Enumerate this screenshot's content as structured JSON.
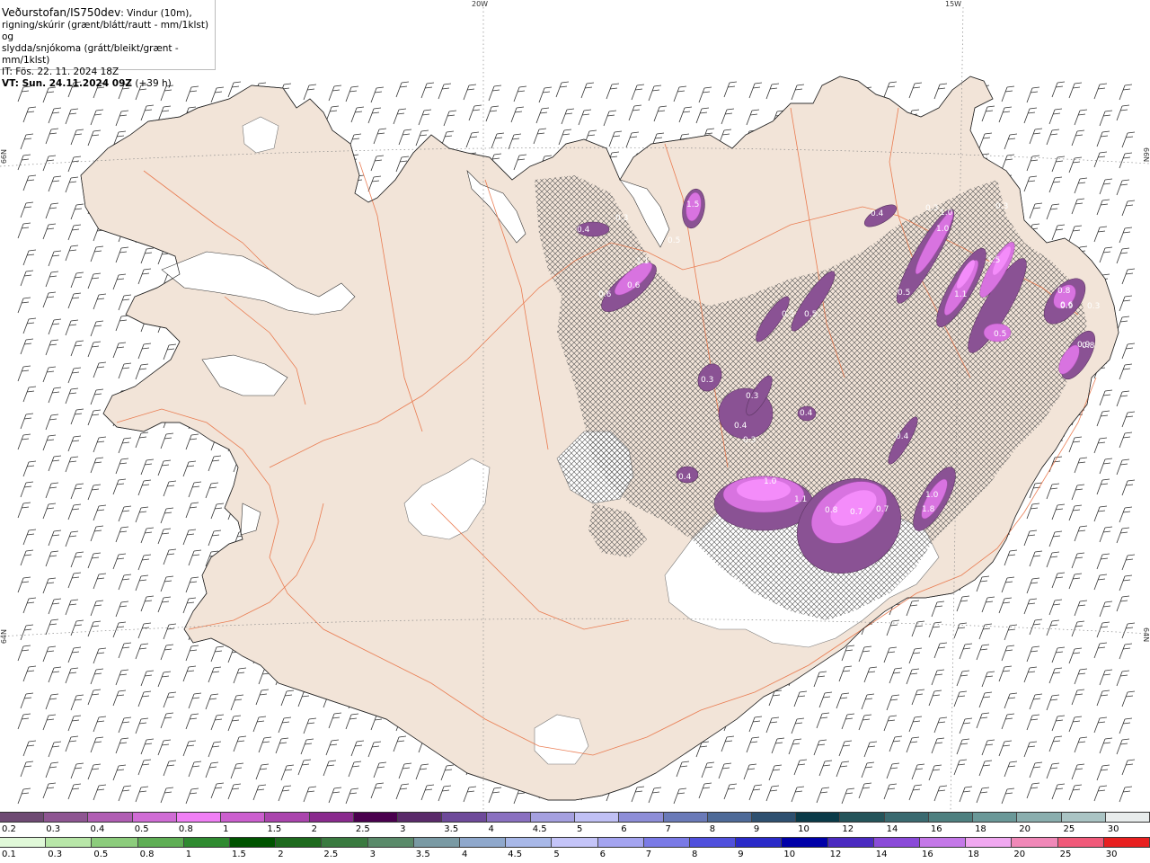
{
  "header": {
    "title": "Veðurstofan/IS750dev",
    "line1_rest": ": Vindur (10m),",
    "line2": "rigning/skúrir (grænt/blátt/rautt - mm/1klst) og",
    "line3": "slydda/snjókoma (grátt/bleikt/grænt - mm/1klst)",
    "it": "IT: Fös. 22. 11. 2024 18Z",
    "vt_label": "VT: Sun. 24.11.2024 09Z",
    "vt_offset": " (+39 h)"
  },
  "grid_labels": {
    "lon20": "20W",
    "lon15": "15W",
    "lat66": "66N",
    "lat64": "64N"
  },
  "precip_values": [
    "0.4",
    "0.3",
    "1.5",
    "0.5",
    "1.1",
    "0.6",
    "0.6",
    "0.4",
    "0.3",
    "1.0",
    "1.0",
    "0.3",
    "0.5",
    "1.5",
    "1.1",
    "0.8",
    "0.6",
    "0.3",
    "0.5",
    "0.5",
    "0.5",
    "0.8",
    "0.3",
    "0.3",
    "0.4",
    "0.3",
    "0.4",
    "0.4",
    "0.4",
    "1.0",
    "1.1",
    "0.8",
    "0.7",
    "0.7",
    "0.9",
    "1.8",
    "1.0",
    "0.9"
  ],
  "legend": {
    "snow": {
      "labels": [
        "0.2",
        "0.3",
        "0.4",
        "0.5",
        "0.8",
        "1",
        "1.5",
        "2",
        "2.5",
        "3",
        "3.5",
        "4",
        "4.5",
        "5",
        "6",
        "7",
        "8",
        "9",
        "10",
        "12",
        "14",
        "16",
        "18",
        "20",
        "25",
        "30"
      ],
      "colors": [
        "#6e4a73",
        "#8e5592",
        "#b05db3",
        "#d06cd5",
        "#f07ff5",
        "#cc5fcf",
        "#aa44ad",
        "#8a2a8e",
        "#4a004e",
        "#5a2a6a",
        "#6e4a9a",
        "#8a70c0",
        "#a5a0e0",
        "#c0c0f5",
        "#8e8ed8",
        "#6a7ab8",
        "#4e6a98",
        "#2e5070",
        "#0a3a48",
        "#24545a",
        "#3a6a70",
        "#4e8080",
        "#6a9898",
        "#8aaeae",
        "#aac4c4",
        "#e8ecec"
      ]
    },
    "rain": {
      "labels": [
        "0.1",
        "0.3",
        "0.5",
        "0.8",
        "1",
        "1.5",
        "2",
        "2.5",
        "3",
        "3.5",
        "4",
        "4.5",
        "5",
        "6",
        "7",
        "8",
        "9",
        "10",
        "12",
        "14",
        "16",
        "18",
        "20",
        "25",
        "30"
      ],
      "colors": [
        "#e0f8d8",
        "#b8e6a8",
        "#8ccc7c",
        "#5fae55",
        "#2f8a30",
        "#005400",
        "#1e6a1e",
        "#3a7a40",
        "#5a8a6a",
        "#7a9aa4",
        "#8fa8cc",
        "#a8b8e8",
        "#c4c4f8",
        "#a4a4f0",
        "#7a7ae6",
        "#5050dc",
        "#2a2ac8",
        "#0000a8",
        "#4a2ac0",
        "#8a4ad8",
        "#c478e8",
        "#f0a8f0",
        "#f088b8",
        "#f05a7a",
        "#e82020"
      ]
    }
  }
}
